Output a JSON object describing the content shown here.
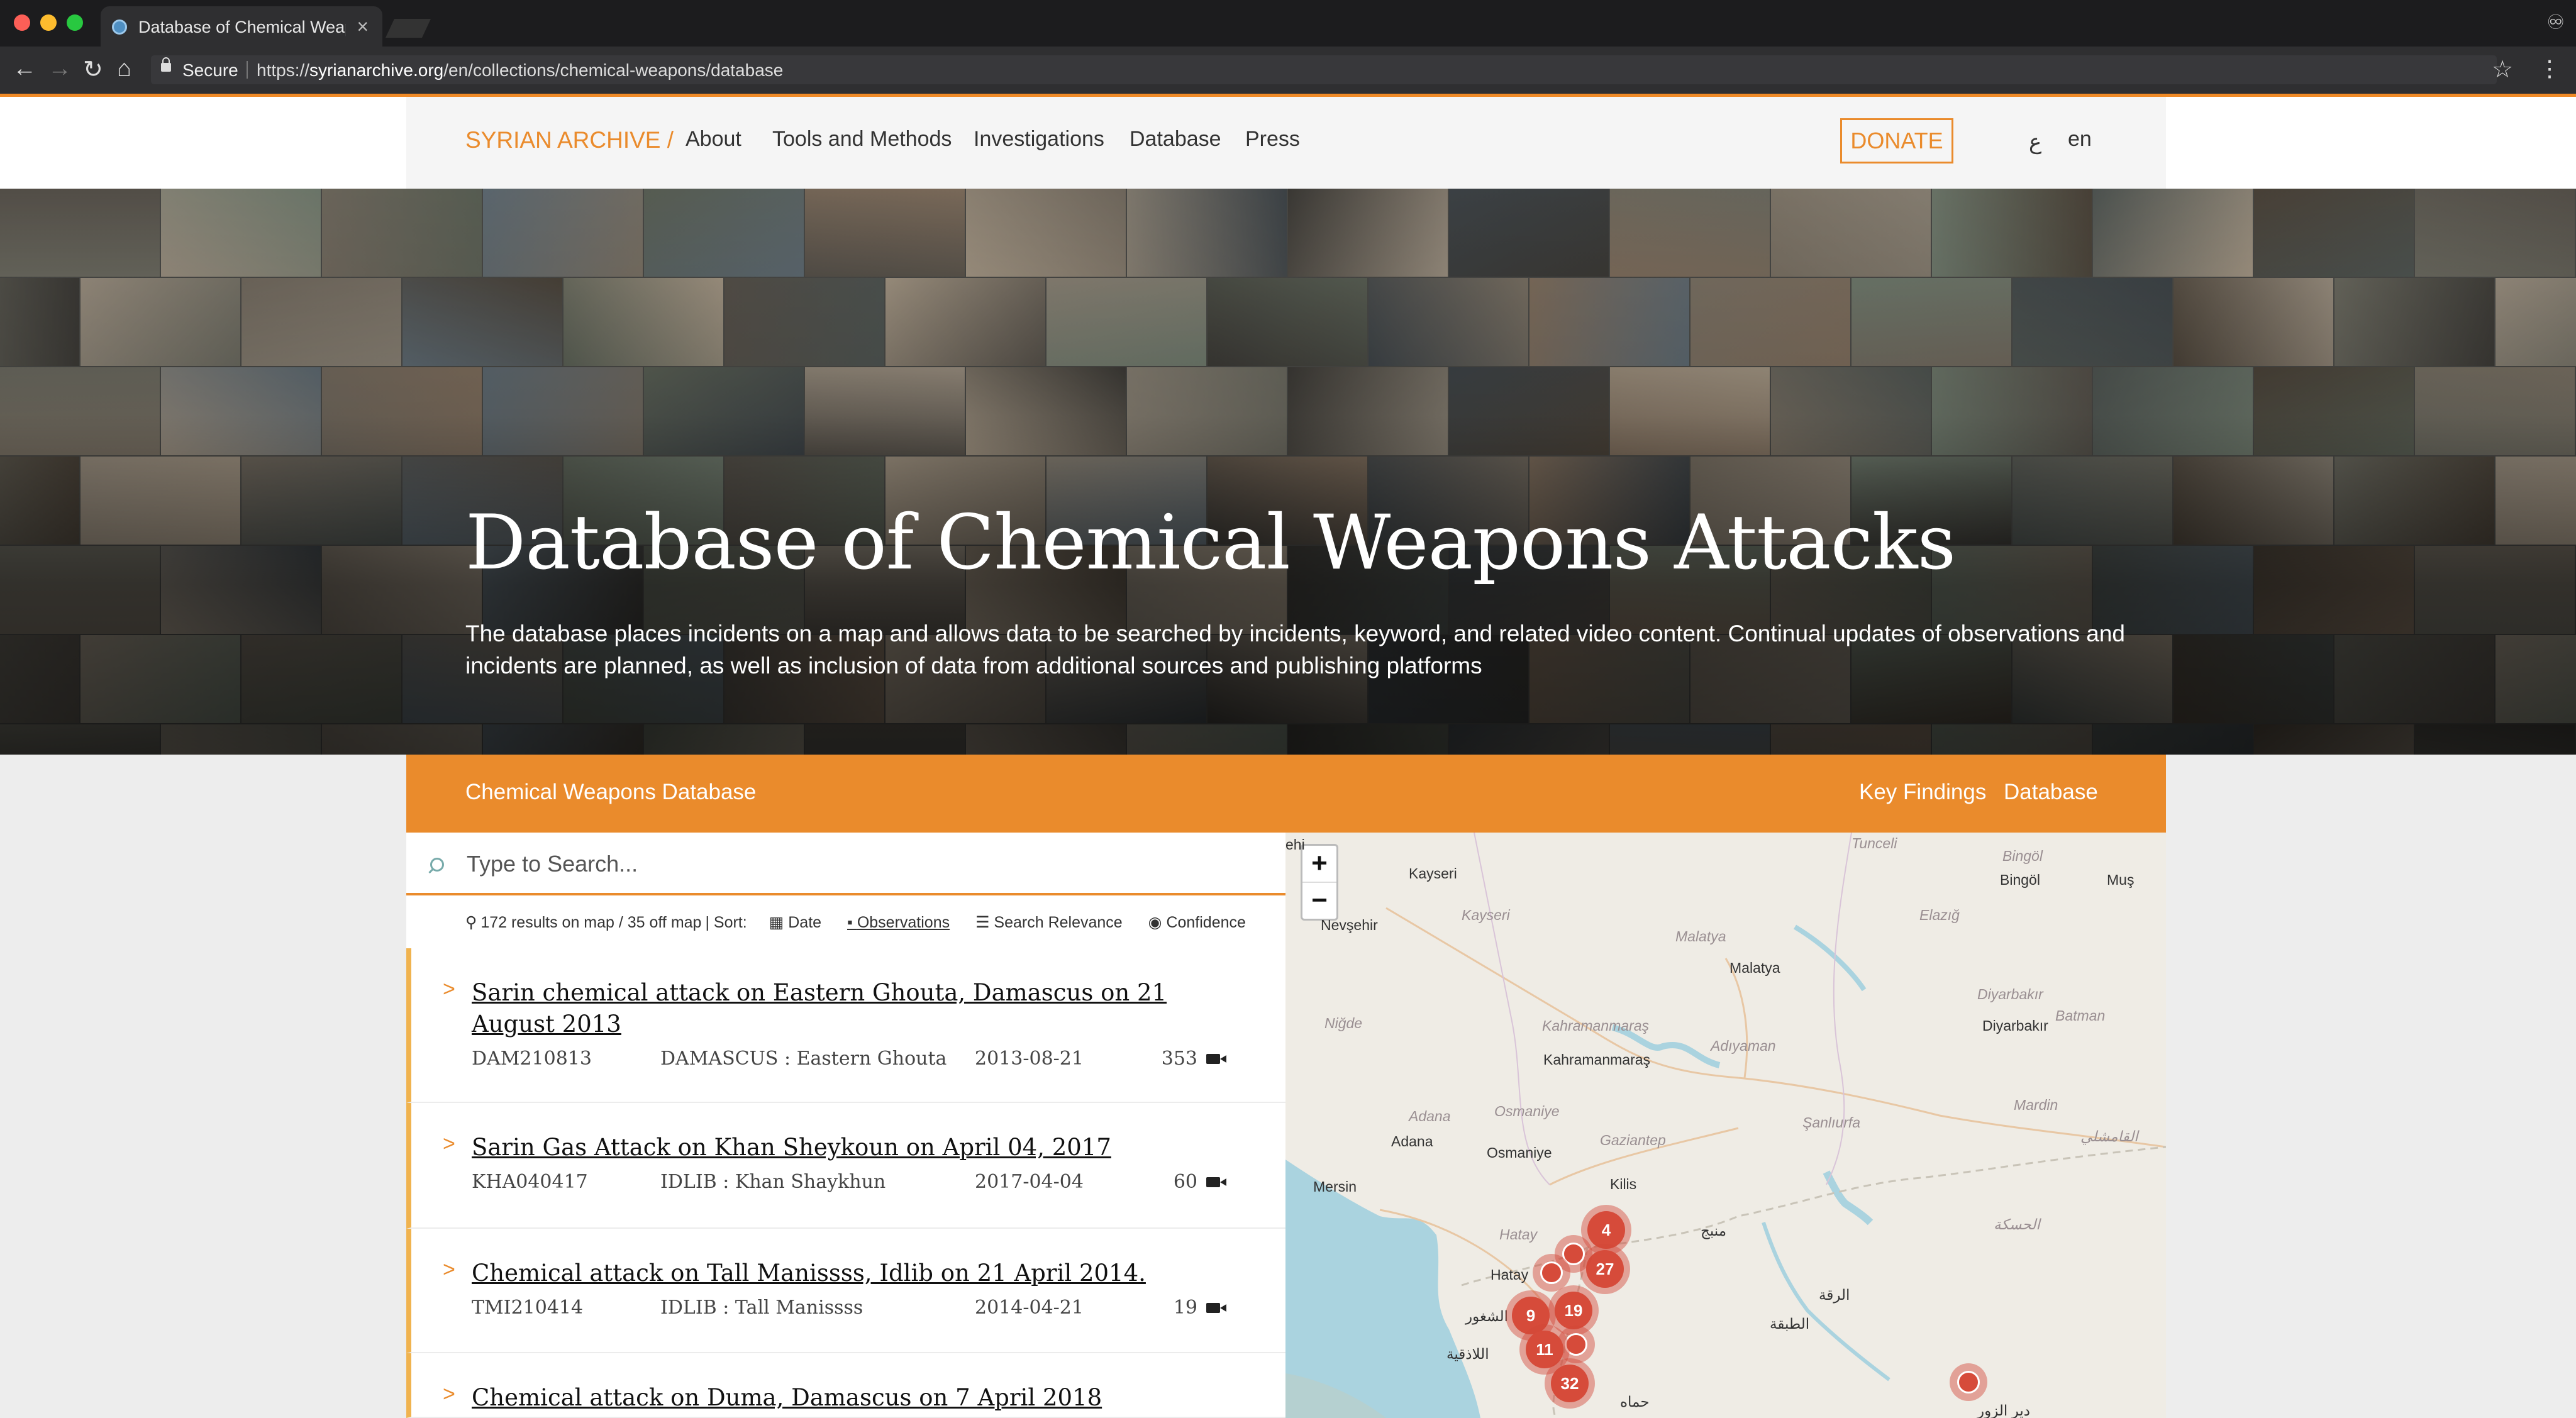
{
  "browser": {
    "tab_title": "Database of Chemical Weapons Attacks",
    "secure_label": "Secure",
    "url_scheme": "https://",
    "url_domain": "syrianarchive.org",
    "url_path": "/en/collections/chemical-weapons/database"
  },
  "nav": {
    "logo": "SYRIAN ARCHIVE /",
    "links": [
      "About",
      "Tools and Methods",
      "Investigations",
      "Database",
      "Press"
    ],
    "donate": "DONATE",
    "lang_ar": "ع",
    "lang_en": "en"
  },
  "hero": {
    "title": "Database of Chemical Weapons Attacks",
    "description": "The database places incidents on a map and allows data to be searched by incidents, keyword, and related video content. Continual updates of observations and incidents are planned, as well as inclusion of data from additional sources and publishing platforms"
  },
  "subbar": {
    "name": "Chemical Weapons Database",
    "key_findings": "Key Findings",
    "database": "Database"
  },
  "search": {
    "placeholder": "Type to Search...",
    "results": "172 results on map / 35 off map",
    "sort_label": "| Sort:",
    "sort_date": "Date",
    "sort_observations": "Observations",
    "sort_relevance": "Search Relevance",
    "sort_confidence": "Confidence"
  },
  "incidents": [
    {
      "title": "Sarin chemical attack on Eastern Ghouta, Damascus on 21 August 2013",
      "code": "DAM210813",
      "location": "DAMASCUS : Eastern Ghouta",
      "date": "2013-08-21",
      "videos": "353"
    },
    {
      "title": "Sarin Gas Attack on Khan Sheykoun on April 04, 2017",
      "code": "KHA040417",
      "location": "IDLIB : Khan Shaykhun",
      "date": "2017-04-04",
      "videos": "60"
    },
    {
      "title": "Chemical attack on Tall Manissss, Idlib on 21 April 2014.",
      "code": "TMI210414",
      "location": "IDLIB : Tall Manissss",
      "date": "2014-04-21",
      "videos": "19"
    },
    {
      "title": "Chemical attack on Duma, Damascus on 7 April 2018",
      "code": "",
      "location": "",
      "date": "",
      "videos": ""
    }
  ],
  "map": {
    "zoom_in": "+",
    "zoom_out": "−",
    "clusters": [
      "4",
      "27",
      "19",
      "9",
      "11",
      "32"
    ],
    "places": {
      "kayseri": "Kayseri",
      "kayseri_prov": "Kayseri",
      "nevsehir": "Nevşehir",
      "tunceli": "Tunceli",
      "bingol": "Bingöl",
      "bingol2": "Bingöl",
      "mus": "Muş",
      "elazig": "Elazığ",
      "malatya_prov": "Malatya",
      "malatya": "Malatya",
      "diyarbakir_prov": "Diyarbakır",
      "diyarbakir": "Diyarbakır",
      "batman": "Batman",
      "nigde": "Niğde",
      "kahramanmaras_prov": "Kahramanmaraş",
      "kahramanmaras": "Kahramanmaraş",
      "adiyaman": "Adıyaman",
      "sanliurfa": "Şanlıurfa",
      "mardin": "Mardin",
      "adana_prov": "Adana",
      "adana": "Adana",
      "osmaniye_prov": "Osmaniye",
      "osmaniye": "Osmaniye",
      "gaziantep": "Gaziantep",
      "mersin": "Mersin",
      "kilis": "Kilis",
      "hatay_prov": "Hatay",
      "hatay": "Hatay",
      "qamishli": "القامشلي",
      "hasaka": "الحسكة",
      "manbij": "منبج",
      "raqqa": "الرقة",
      "tabqa": "الطبقة",
      "shughur": "الشغور",
      "latakia": "اللاذقية",
      "hama": "حماه",
      "deir": "دير الزور",
      "ahi": "ehi"
    }
  }
}
